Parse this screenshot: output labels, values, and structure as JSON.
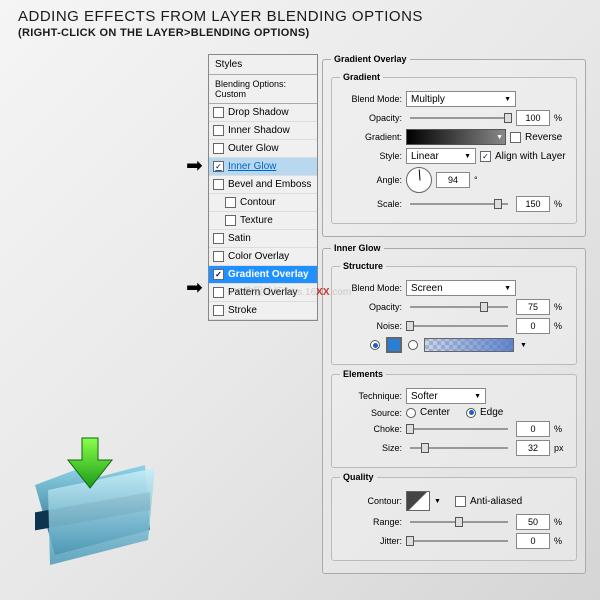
{
  "title": "ADDING EFFECTS FROM LAYER BLENDING OPTIONS",
  "subtitle": "(RIGHT-CLICK ON THE LAYER>BLENDING OPTIONS)",
  "styles": {
    "header": "Styles",
    "sub": "Blending Options: Custom",
    "items": [
      {
        "label": "Drop Shadow",
        "checked": false
      },
      {
        "label": "Inner Shadow",
        "checked": false
      },
      {
        "label": "Outer Glow",
        "checked": false
      },
      {
        "label": "Inner Glow",
        "checked": true
      },
      {
        "label": "Bevel and Emboss",
        "checked": false
      },
      {
        "label": "Contour",
        "checked": false
      },
      {
        "label": "Texture",
        "checked": false
      },
      {
        "label": "Satin",
        "checked": false
      },
      {
        "label": "Color Overlay",
        "checked": false
      },
      {
        "label": "Gradient Overlay",
        "checked": true
      },
      {
        "label": "Pattern Overlay",
        "checked": false
      },
      {
        "label": "Stroke",
        "checked": false
      }
    ]
  },
  "gradOverlay": {
    "legend": "Gradient Overlay",
    "gradientLegend": "Gradient",
    "blendModeLabel": "Blend Mode:",
    "blendMode": "Multiply",
    "opacityLabel": "Opacity:",
    "opacity": "100",
    "gradientLabel": "Gradient:",
    "reverseLabel": "Reverse",
    "styleLabel": "Style:",
    "style": "Linear",
    "alignLabel": "Align with Layer",
    "angleLabel": "Angle:",
    "angle": "94",
    "scaleLabel": "Scale:",
    "scale": "150"
  },
  "innerGlow": {
    "legend": "Inner Glow",
    "structureLegend": "Structure",
    "blendModeLabel": "Blend Mode:",
    "blendMode": "Screen",
    "opacityLabel": "Opacity:",
    "opacity": "75",
    "noiseLabel": "Noise:",
    "noise": "0",
    "elementsLegend": "Elements",
    "techniqueLabel": "Technique:",
    "technique": "Softer",
    "sourceLabel": "Source:",
    "centerLabel": "Center",
    "edgeLabel": "Edge",
    "chokeLabel": "Choke:",
    "choke": "0",
    "sizeLabel": "Size:",
    "size": "32",
    "qualityLegend": "Quality",
    "contourLabel": "Contour:",
    "antiLabel": "Anti-aliased",
    "rangeLabel": "Range:",
    "range": "50",
    "jitterLabel": "Jitter:",
    "jitter": "0"
  },
  "units": {
    "pct": "%",
    "deg": "°",
    "px": "px"
  },
  "watermark": {
    "pre": "PS教程论坛\nbbs.16",
    "xx": "XX",
    "post": ".com"
  }
}
